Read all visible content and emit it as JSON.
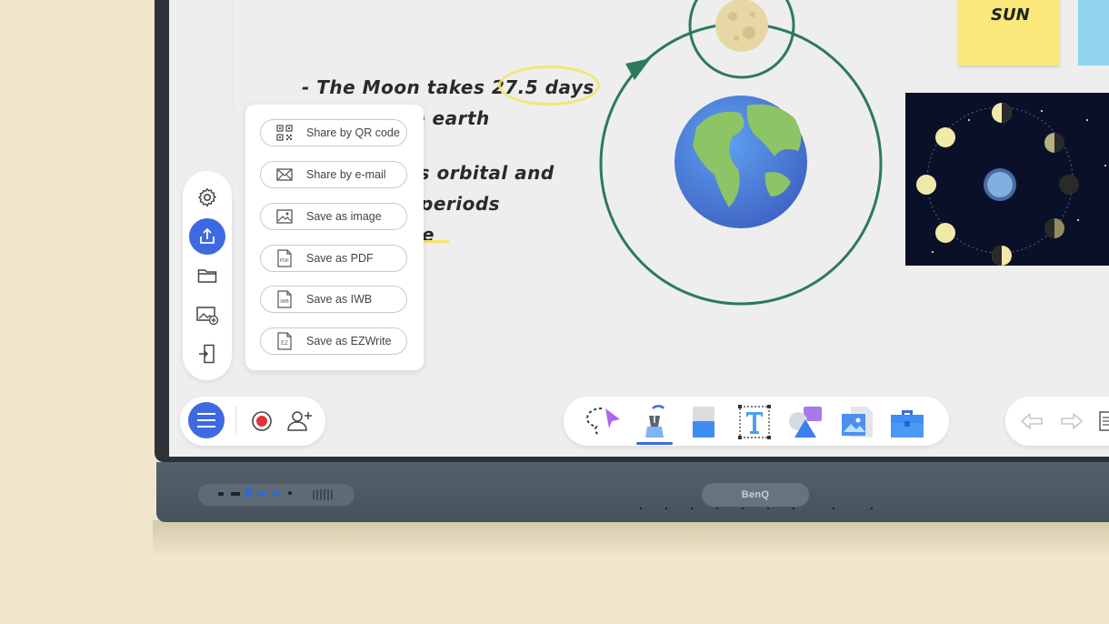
{
  "whiteboard": {
    "text_lines": [
      "- The Moon takes 27.5 days",
      "e earth",
      "'s orbital and",
      "periods",
      "e"
    ],
    "sticky_notes": [
      {
        "label": "SUN",
        "color": "#fbe87a"
      },
      {
        "label": "",
        "color": "#8fd3f0"
      }
    ]
  },
  "share_menu": {
    "items": [
      {
        "label": "Share by QR code",
        "icon": "qr-code-icon"
      },
      {
        "label": "Share by e-mail",
        "icon": "mail-icon"
      },
      {
        "label": "Save as image",
        "icon": "image-icon"
      },
      {
        "label": "Save as PDF",
        "icon": "pdf-file-icon",
        "badge": "PDF"
      },
      {
        "label": "Save as IWB",
        "icon": "iwb-file-icon",
        "badge": "IWB"
      },
      {
        "label": "Save as EZWrite",
        "icon": "ezwrite-file-icon",
        "badge": "EZ"
      }
    ]
  },
  "side_rail": {
    "items": [
      "settings",
      "share",
      "folder",
      "insert-image",
      "exit"
    ],
    "active": "share"
  },
  "device": {
    "brand": "BenQ"
  },
  "colors": {
    "accent": "#3d6ae0",
    "orbit": "#2d7a5a",
    "highlight": "#f2e46a"
  }
}
